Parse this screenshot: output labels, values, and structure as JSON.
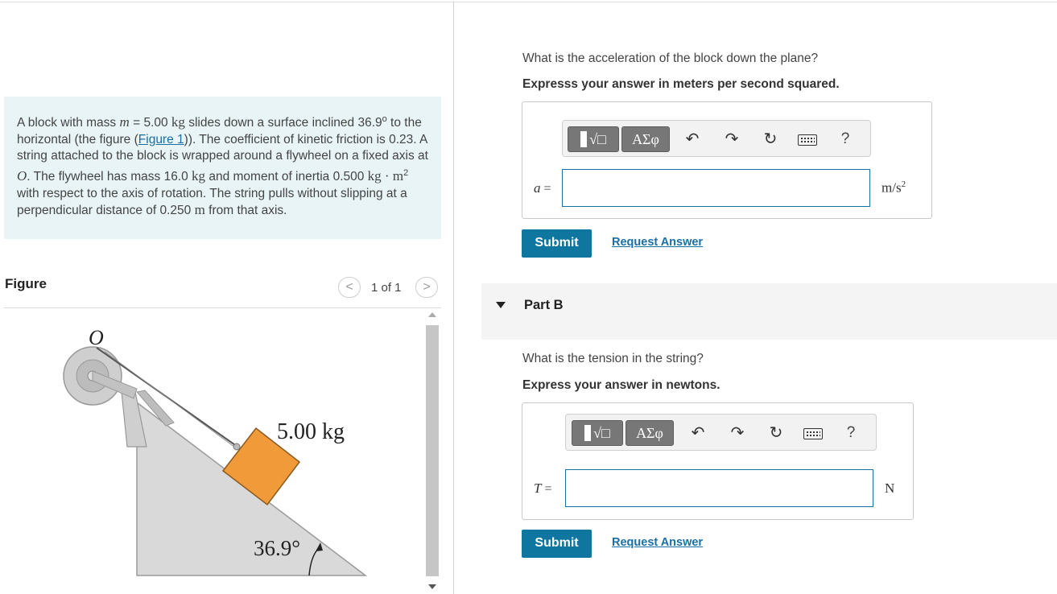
{
  "problem": {
    "t1": "A block with mass ",
    "m_var": "m",
    "t2": " = 5.00 ",
    "kg1": "kg",
    "t3": " slides down a surface inclined 36.9",
    "deg": "o",
    "t4": " to the horizontal (the figure (",
    "figure_link": "Figure 1",
    "t5": ")). The coefficient of kinetic friction is 0.23. A string attached to the block is wrapped around a flywheel on a fixed axis at ",
    "o_var": "O",
    "t6": ". The flywheel has mass 16.0 ",
    "kg2": "kg",
    "t7": " and moment of inertia 0.500 ",
    "kgm2": "kg · m",
    "sq": "2",
    "t8": " with respect to the axis of rotation. The string pulls without slipping at a perpendicular distance of 0.250 ",
    "m_unit": "m",
    "t9": " from that axis."
  },
  "figure": {
    "title": "Figure",
    "prev": "<",
    "next": ">",
    "count": "1 of 1",
    "label_o": "O",
    "label_mass": "5.00 kg",
    "label_angle": "36.9°",
    "colors": {
      "incline": "#d9d9d9",
      "block": "#f09a3a",
      "wheel": "#c8c8c8"
    }
  },
  "part_a": {
    "question": "What is the acceleration of the block down the plane?",
    "instruction": "Expresss your answer in meters per second squared.",
    "toolbar": {
      "templates": "√□",
      "symbols": "ΑΣφ",
      "undo": "↶",
      "redo": "↷",
      "reset": "↻",
      "keyboard": "keyboard-icon",
      "help": "?"
    },
    "variable": "a",
    "equals": " =",
    "input_value": "",
    "unit": "m/s",
    "unit_sup": "2",
    "submit": "Submit",
    "request": "Request Answer"
  },
  "part_b": {
    "header": "Part B",
    "question": "What is the tension in the string?",
    "instruction": "Express your answer in newtons.",
    "toolbar": {
      "templates": "√□",
      "symbols": "ΑΣφ",
      "undo": "↶",
      "redo": "↷",
      "reset": "↻",
      "keyboard": "keyboard-icon",
      "help": "?"
    },
    "variable": "T",
    "equals": " =",
    "input_value": "",
    "unit": "N",
    "submit": "Submit",
    "request": "Request Answer"
  },
  "colors": {
    "accent": "#0f769f",
    "link": "#1a6fa3",
    "problem_bg": "#e8f4f6"
  }
}
